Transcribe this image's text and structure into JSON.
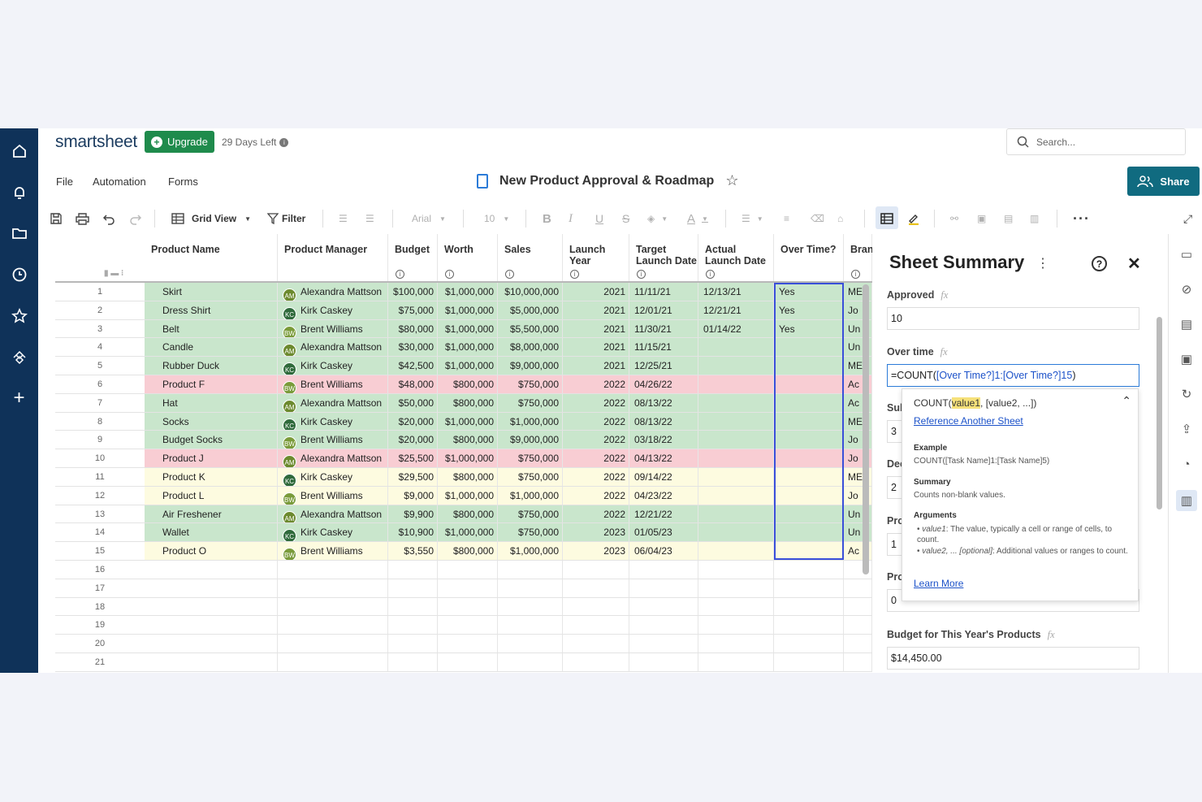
{
  "topbar": {
    "logo": "smartsheet",
    "upgrade": "Upgrade",
    "days_left": "29 Days Left",
    "search_placeholder": "Search..."
  },
  "menu": {
    "file": "File",
    "automation": "Automation",
    "forms": "Forms",
    "title": "New Product Approval & Roadmap",
    "share": "Share"
  },
  "toolbar": {
    "view": "Grid View",
    "filter": "Filter",
    "font": "Arial",
    "size": "10",
    "bold": "B",
    "italic": "I",
    "underline": "U",
    "strike": "S",
    "textcolor": "A"
  },
  "columns": [
    "Product Name",
    "Product Manager",
    "Budget",
    "Worth",
    "Sales",
    "Launch Year",
    "Target Launch Date",
    "Actual Launch Date",
    "Over Time?",
    "Bran"
  ],
  "rows": [
    {
      "n": "1",
      "name": "Skirt",
      "mi": "AM",
      "mgr": "Alexandra Mattson",
      "budget": "$100,000",
      "worth": "$1,000,000",
      "sales": "$10,000,000",
      "year": "2021",
      "target": "11/11/21",
      "actual": "12/13/21",
      "over": "Yes",
      "brand": "ME",
      "color": "green"
    },
    {
      "n": "2",
      "name": "Dress Shirt",
      "mi": "KC",
      "mgr": "Kirk Caskey",
      "budget": "$75,000",
      "worth": "$1,000,000",
      "sales": "$5,000,000",
      "year": "2021",
      "target": "12/01/21",
      "actual": "12/21/21",
      "over": "Yes",
      "brand": "Jo",
      "color": "green"
    },
    {
      "n": "3",
      "name": "Belt",
      "mi": "BW",
      "mgr": "Brent Williams",
      "budget": "$80,000",
      "worth": "$1,000,000",
      "sales": "$5,500,000",
      "year": "2021",
      "target": "11/30/21",
      "actual": "01/14/22",
      "over": "Yes",
      "brand": "Un",
      "color": "green"
    },
    {
      "n": "4",
      "name": "Candle",
      "mi": "AM",
      "mgr": "Alexandra Mattson",
      "budget": "$30,000",
      "worth": "$1,000,000",
      "sales": "$8,000,000",
      "year": "2021",
      "target": "11/15/21",
      "actual": "",
      "over": "",
      "brand": "Un",
      "color": "green"
    },
    {
      "n": "5",
      "name": "Rubber Duck",
      "mi": "KC",
      "mgr": "Kirk Caskey",
      "budget": "$42,500",
      "worth": "$1,000,000",
      "sales": "$9,000,000",
      "year": "2021",
      "target": "12/25/21",
      "actual": "",
      "over": "",
      "brand": "ME",
      "color": "green"
    },
    {
      "n": "6",
      "name": "Product F",
      "mi": "BW",
      "mgr": "Brent Williams",
      "budget": "$48,000",
      "worth": "$800,000",
      "sales": "$750,000",
      "year": "2022",
      "target": "04/26/22",
      "actual": "",
      "over": "",
      "brand": "Ac",
      "color": "red"
    },
    {
      "n": "7",
      "name": "Hat",
      "mi": "AM",
      "mgr": "Alexandra Mattson",
      "budget": "$50,000",
      "worth": "$800,000",
      "sales": "$750,000",
      "year": "2022",
      "target": "08/13/22",
      "actual": "",
      "over": "",
      "brand": "Ac",
      "color": "green"
    },
    {
      "n": "8",
      "name": "Socks",
      "mi": "KC",
      "mgr": "Kirk Caskey",
      "budget": "$20,000",
      "worth": "$1,000,000",
      "sales": "$1,000,000",
      "year": "2022",
      "target": "08/13/22",
      "actual": "",
      "over": "",
      "brand": "ME",
      "color": "green"
    },
    {
      "n": "9",
      "name": "Budget Socks",
      "mi": "BW",
      "mgr": "Brent Williams",
      "budget": "$20,000",
      "worth": "$800,000",
      "sales": "$9,000,000",
      "year": "2022",
      "target": "03/18/22",
      "actual": "",
      "over": "",
      "brand": "Jo",
      "color": "green"
    },
    {
      "n": "10",
      "name": "Product J",
      "mi": "AM",
      "mgr": "Alexandra Mattson",
      "budget": "$25,500",
      "worth": "$1,000,000",
      "sales": "$750,000",
      "year": "2022",
      "target": "04/13/22",
      "actual": "",
      "over": "",
      "brand": "Jo",
      "color": "red"
    },
    {
      "n": "11",
      "name": "Product K",
      "mi": "KC",
      "mgr": "Kirk Caskey",
      "budget": "$29,500",
      "worth": "$800,000",
      "sales": "$750,000",
      "year": "2022",
      "target": "09/14/22",
      "actual": "",
      "over": "",
      "brand": "ME",
      "color": "yellow"
    },
    {
      "n": "12",
      "name": "Product L",
      "mi": "BW",
      "mgr": "Brent Williams",
      "budget": "$9,000",
      "worth": "$1,000,000",
      "sales": "$1,000,000",
      "year": "2022",
      "target": "04/23/22",
      "actual": "",
      "over": "",
      "brand": "Jo",
      "color": "yellow"
    },
    {
      "n": "13",
      "name": "Air Freshener",
      "mi": "AM",
      "mgr": "Alexandra Mattson",
      "budget": "$9,900",
      "worth": "$800,000",
      "sales": "$750,000",
      "year": "2022",
      "target": "12/21/22",
      "actual": "",
      "over": "",
      "brand": "Un",
      "color": "green"
    },
    {
      "n": "14",
      "name": "Wallet",
      "mi": "KC",
      "mgr": "Kirk Caskey",
      "budget": "$10,900",
      "worth": "$1,000,000",
      "sales": "$750,000",
      "year": "2023",
      "target": "01/05/23",
      "actual": "",
      "over": "",
      "brand": "Un",
      "color": "green"
    },
    {
      "n": "15",
      "name": "Product O",
      "mi": "BW",
      "mgr": "Brent Williams",
      "budget": "$3,550",
      "worth": "$800,000",
      "sales": "$1,000,000",
      "year": "2023",
      "target": "06/04/23",
      "actual": "",
      "over": "",
      "brand": "Ac",
      "color": "yellow"
    }
  ],
  "empty_rows": [
    "16",
    "17",
    "18",
    "19",
    "20",
    "21"
  ],
  "panel": {
    "title": "Sheet Summary",
    "approved_label": "Approved",
    "approved_value": "10",
    "overtime_label": "Over time",
    "formula_prefix": "=COUNT(",
    "formula_ref": "[Over Time?]1:[Over Time?]15",
    "formula_suffix": ")",
    "hidden_labels": [
      "Sub",
      "Dec",
      "Pro",
      "Pro"
    ],
    "hidden_values": [
      "3",
      "2",
      "1",
      "0"
    ],
    "budget_label": "Budget for This Year's Products",
    "budget_value": "$14,450.00"
  },
  "popup": {
    "sig_prefix": "COUNT(",
    "sig_arg": "value1",
    "sig_rest": ", [value2, ...])",
    "ref_link": "Reference Another Sheet",
    "example_h": "Example",
    "example": "COUNT([Task Name]1:[Task Name]5)",
    "summary_h": "Summary",
    "summary": "Counts non-blank values.",
    "args_h": "Arguments",
    "arg1_name": "value1",
    "arg1": ": The value, typically a cell or range of cells, to count.",
    "arg2_name": "value2, ... [optional]",
    "arg2": ": Additional values or ranges to count.",
    "learn": "Learn More"
  },
  "colors": {
    "green": "#c9e6cc",
    "red": "#f8cdd3",
    "yellow": "#fdfbe0",
    "rail": "#0f3259",
    "share": "#106b80",
    "upgrade": "#1f8b4c"
  }
}
